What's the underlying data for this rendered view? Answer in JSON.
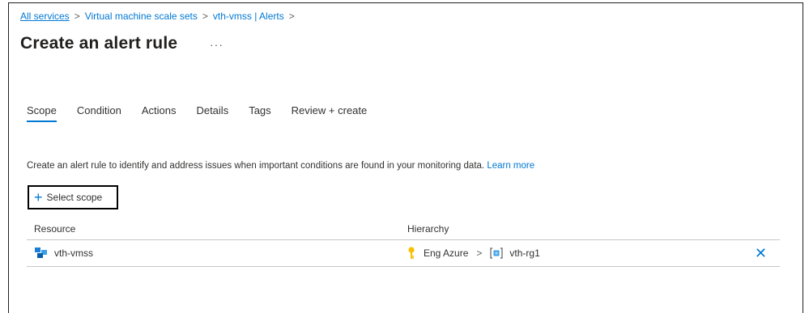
{
  "breadcrumb": {
    "items": [
      "All services",
      "Virtual machine scale sets",
      "vth-vmss | Alerts"
    ],
    "separator": ">"
  },
  "page": {
    "title": "Create an alert rule",
    "more": "···"
  },
  "tabs": [
    {
      "label": "Scope",
      "active": true
    },
    {
      "label": "Condition",
      "active": false
    },
    {
      "label": "Actions",
      "active": false
    },
    {
      "label": "Details",
      "active": false
    },
    {
      "label": "Tags",
      "active": false
    },
    {
      "label": "Review + create",
      "active": false
    }
  ],
  "description": {
    "text": "Create an alert rule to identify and address issues when important conditions are found in your monitoring data.",
    "link": "Learn more"
  },
  "select_scope": {
    "icon": "plus-icon",
    "label": "Select scope"
  },
  "table": {
    "headers": {
      "resource": "Resource",
      "hierarchy": "Hierarchy"
    },
    "rows": [
      {
        "resource": "vth-vmss",
        "resource_icon": "vmss-icon",
        "hierarchy": [
          "Eng Azure",
          "vth-rg1"
        ],
        "hierarchy_icons": [
          "key-icon",
          "resource-group-icon"
        ],
        "remove_icon": "close-icon"
      }
    ]
  },
  "colors": {
    "accent": "#0078d4",
    "text": "#323130",
    "key": "#f8c000"
  }
}
